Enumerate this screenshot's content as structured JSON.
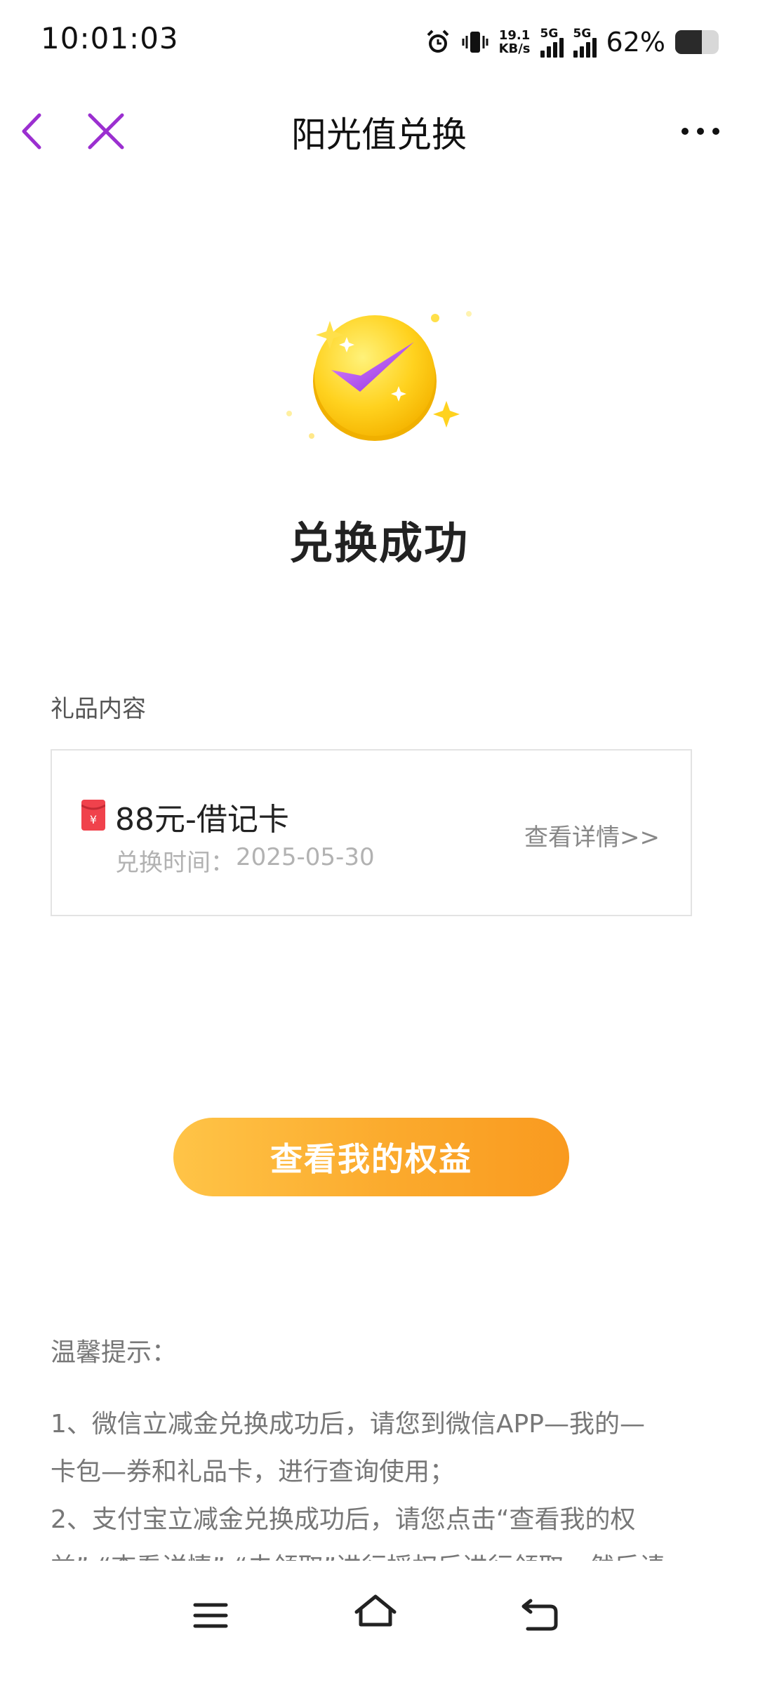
{
  "status_bar": {
    "time": "10:01:03",
    "net_speed_value": "19.1",
    "net_speed_unit": "KB/s",
    "signal_1_label": "5G",
    "signal_2_label": "5G",
    "battery_percent_text": "62%",
    "battery_level": 0.62,
    "icons": [
      "alarm-icon",
      "vibrate-icon",
      "signal-icon",
      "battery-icon"
    ]
  },
  "nav": {
    "title": "阳光值兑换",
    "icons": [
      "back-icon",
      "close-icon",
      "more-icon"
    ],
    "accent_color": "#9b2fd0"
  },
  "success": {
    "icon": "check-coin-icon",
    "title": "兑换成功"
  },
  "gift": {
    "section_label": "礼品内容",
    "icon": "red-envelope-icon",
    "name": "88元-借记卡",
    "time_label": "兑换时间：",
    "time": "2025-05-30",
    "detail_link": "查看详情>>"
  },
  "primary_button": {
    "label": "查看我的权益",
    "color_start": "#ffc447",
    "color_end": "#f99a1f"
  },
  "tips": {
    "title": "温馨提示：",
    "lines": [
      "1、微信立减金兑换成功后，请您到微信APP—我的—",
      "卡包—券和礼品卡，进行查询使用；",
      "2、支付宝立减金兑换成功后，请您点击“查看我的权",
      "益”-“查看详情”-“去领取”进行授权后进行领取，然后请"
    ]
  },
  "system_nav": {
    "icons": [
      "menu-icon",
      "home-icon",
      "return-icon"
    ]
  }
}
